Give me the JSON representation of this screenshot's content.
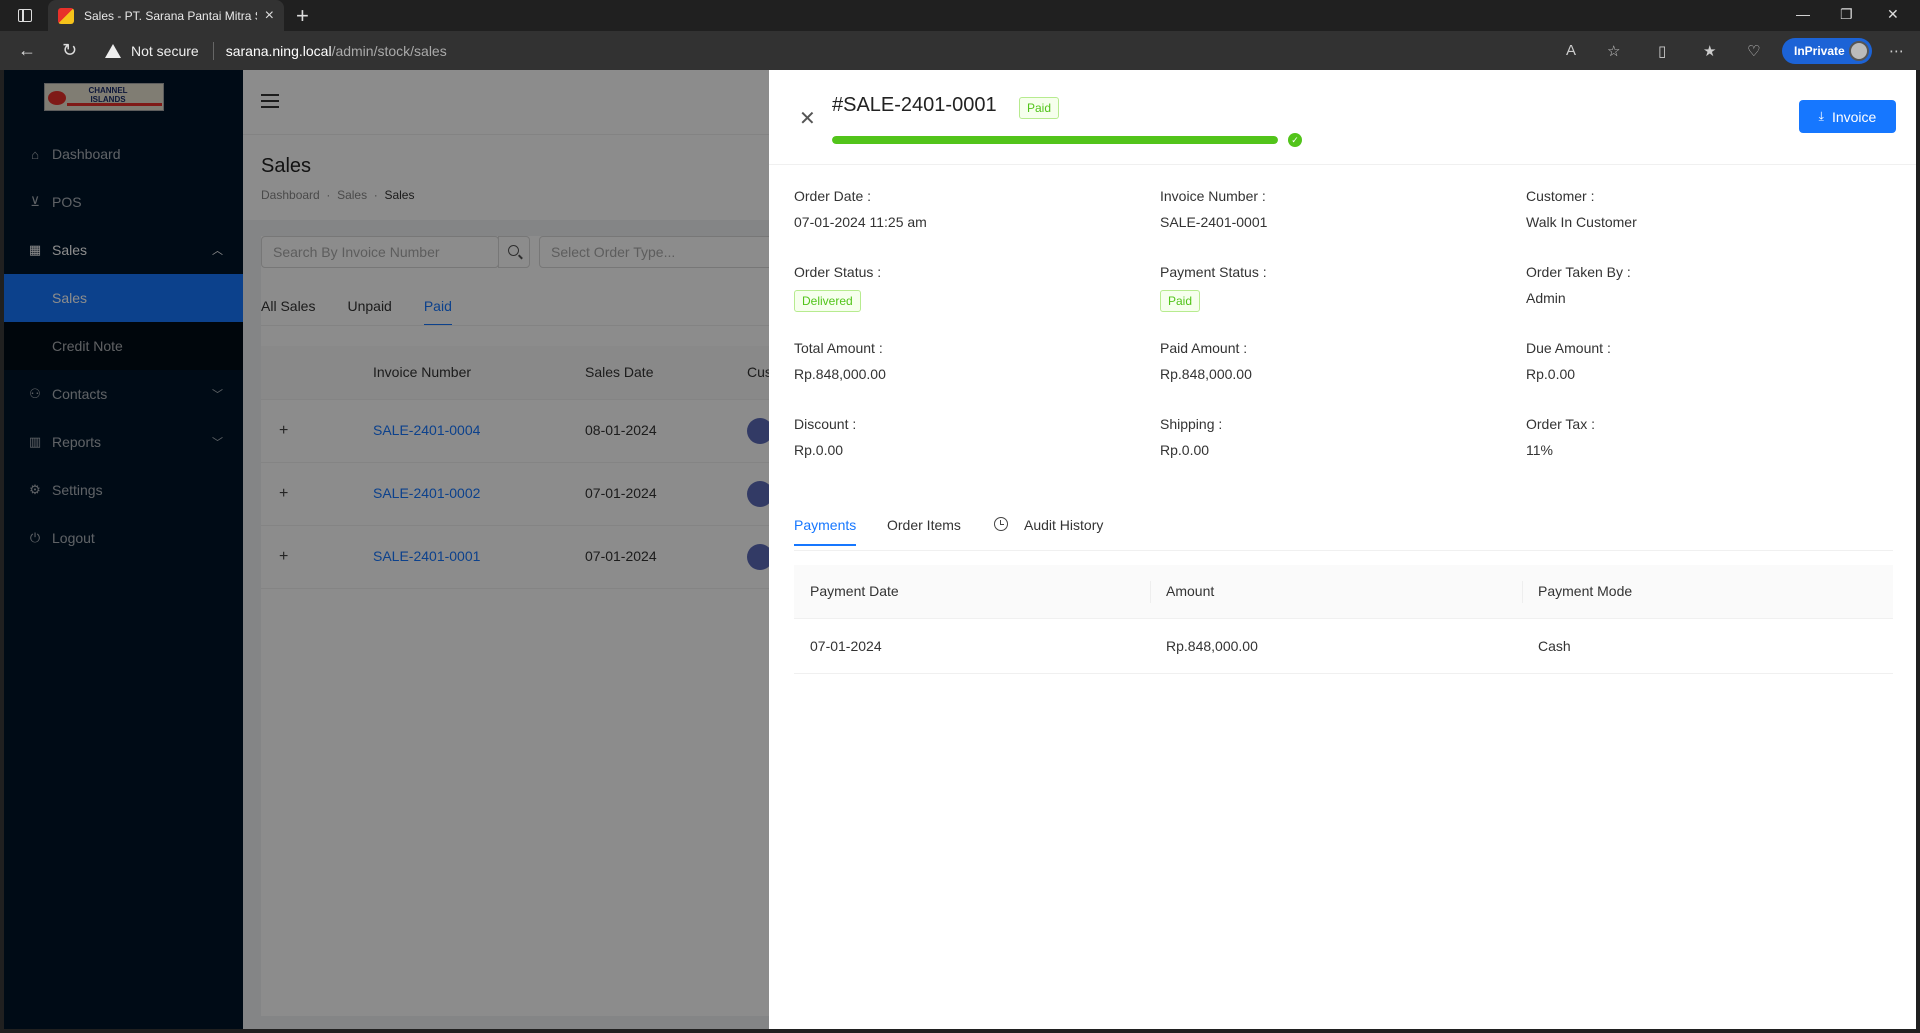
{
  "browser": {
    "tab_title": "Sales - PT. Sarana Pantai Mitra Se",
    "not_secure": "Not secure",
    "url_host": "sarana.ning.local",
    "url_path": "/admin/stock/sales",
    "inprivate": "InPrivate"
  },
  "logo": {
    "text": "CHANNEL ISLANDS"
  },
  "sidebar": {
    "items": [
      {
        "label": "Dashboard",
        "icon": "home-icon"
      },
      {
        "label": "POS",
        "icon": "cart-icon"
      },
      {
        "label": "Sales",
        "icon": "table-icon"
      },
      {
        "label": "Contacts",
        "icon": "contacts-icon"
      },
      {
        "label": "Reports",
        "icon": "bar-chart-icon"
      },
      {
        "label": "Settings",
        "icon": "gear-icon"
      },
      {
        "label": "Logout",
        "icon": "logout-icon"
      }
    ],
    "sales_sub": [
      {
        "label": "Sales"
      },
      {
        "label": "Credit Note"
      }
    ]
  },
  "page": {
    "title": "Sales",
    "breadcrumb": [
      "Dashboard",
      "Sales",
      "Sales"
    ],
    "search_placeholder": "Search By Invoice Number",
    "select_placeholder": "Select Order Type...",
    "tabs": [
      "All Sales",
      "Unpaid",
      "Paid"
    ],
    "table": {
      "headers": [
        "Invoice Number",
        "Sales Date",
        "Cus"
      ],
      "rows": [
        {
          "invoice": "SALE-2401-0004",
          "date": "08-01-2024"
        },
        {
          "invoice": "SALE-2401-0002",
          "date": "07-01-2024"
        },
        {
          "invoice": "SALE-2401-0001",
          "date": "07-01-2024"
        }
      ]
    }
  },
  "drawer": {
    "title": "#SALE-2401-0001",
    "status_tag": "Paid",
    "progress_percent": 100,
    "invoice_button": "Invoice",
    "fields": {
      "order_date_label": "Order Date",
      "order_date": "07-01-2024 11:25 am",
      "invoice_number_label": "Invoice Number",
      "invoice_number": "SALE-2401-0001",
      "customer_label": "Customer",
      "customer": "Walk In Customer",
      "order_status_label": "Order Status",
      "order_status": "Delivered",
      "payment_status_label": "Payment Status",
      "payment_status": "Paid",
      "order_taken_by_label": "Order Taken By",
      "order_taken_by": "Admin",
      "total_amount_label": "Total Amount",
      "total_amount": "Rp.848,000.00",
      "paid_amount_label": "Paid Amount",
      "paid_amount": "Rp.848,000.00",
      "due_amount_label": "Due Amount",
      "due_amount": "Rp.0.00",
      "discount_label": "Discount",
      "discount": "Rp.0.00",
      "shipping_label": "Shipping",
      "shipping": "Rp.0.00",
      "order_tax_label": "Order Tax",
      "order_tax": "11%"
    },
    "tabs": [
      "Payments",
      "Order Items",
      "Audit History"
    ],
    "payments": {
      "headers": [
        "Payment Date",
        "Amount",
        "Payment Mode"
      ],
      "rows": [
        {
          "date": "07-01-2024",
          "amount": "Rp.848,000.00",
          "mode": "Cash"
        }
      ]
    }
  },
  "colors": {
    "accent": "#1677ff",
    "success": "#52c41a",
    "sidebar": "#001529"
  }
}
